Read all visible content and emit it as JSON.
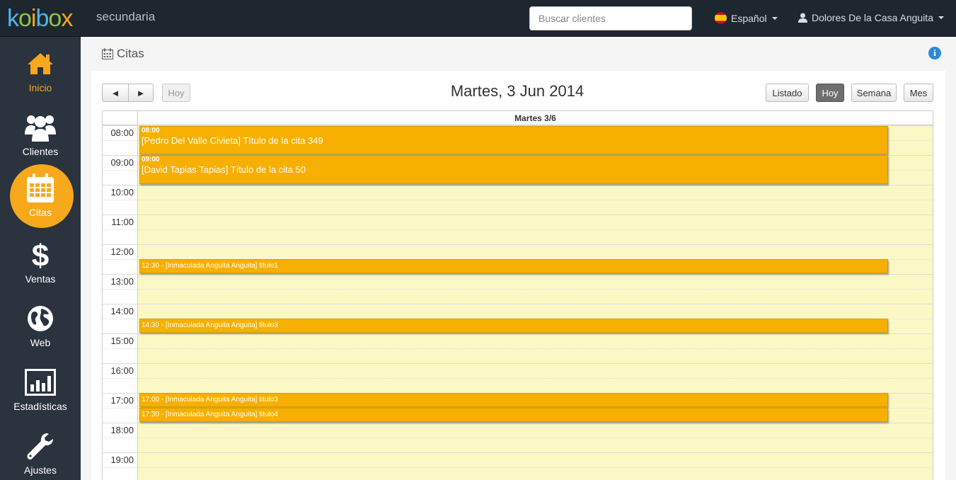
{
  "topbar": {
    "logo": "koibox",
    "account": "secundaria",
    "search_placeholder": "Buscar clientes",
    "language": "Español",
    "user": "Dolores De la Casa Anguita"
  },
  "sidebar": {
    "items": [
      {
        "label": "Inicio",
        "icon": "home-icon"
      },
      {
        "label": "Clientes",
        "icon": "users-icon"
      },
      {
        "label": "Citas",
        "icon": "calendar-icon"
      },
      {
        "label": "Ventas",
        "icon": "dollar-icon"
      },
      {
        "label": "Web",
        "icon": "globe-icon"
      },
      {
        "label": "Estadísticas",
        "icon": "bar-chart-icon"
      },
      {
        "label": "Ajustes",
        "icon": "wrench-icon"
      }
    ]
  },
  "page": {
    "title": "Citas"
  },
  "calendar": {
    "prev": "◄",
    "next": "►",
    "today_button": "Hoy",
    "title": "Martes, 3 Jun 2014",
    "views": {
      "list": "Listado",
      "day": "Hoy",
      "week": "Semana",
      "month": "Mes"
    },
    "day_header": "Martes 3/6",
    "hours": [
      "08:00",
      "09:00",
      "10:00",
      "11:00",
      "12:00",
      "13:00",
      "14:00",
      "15:00",
      "16:00",
      "17:00",
      "18:00",
      "19:00"
    ],
    "events": [
      {
        "time": "08:00",
        "title": "[Pedro Del Valle Civieta] Título de la cita 349"
      },
      {
        "time": "09:00",
        "title": "[David Tapias Tapias] Título de la cita 50"
      },
      {
        "line": "12:30 - [Inmaculada Anguita Anguita] titulo1"
      },
      {
        "line": "14:30 - [Inmaculada Anguita Anguita] titulo3"
      },
      {
        "line": "17:00 - [Inmaculada Anguita Anguita] titulo3"
      },
      {
        "line": "17:30 - [Inmaculada Anguita Anguita] titulo4"
      }
    ]
  },
  "colors": {
    "accent": "#f7a81b",
    "event": "#f7b000",
    "day_background": "#fcf8c6",
    "topbar": "#1e262f",
    "sidebar": "#2a333e"
  }
}
